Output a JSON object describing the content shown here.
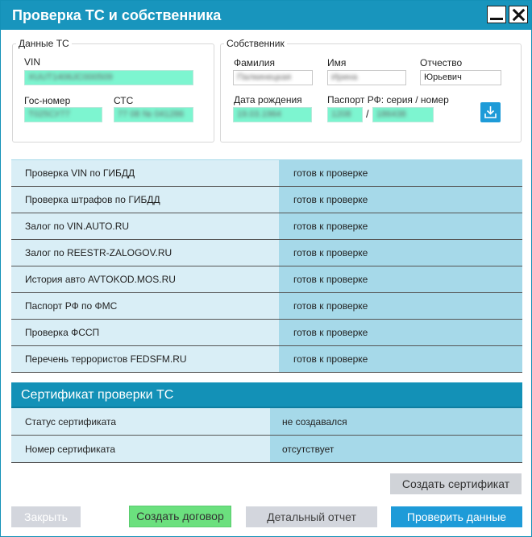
{
  "window": {
    "title": "Проверка ТС и собственника",
    "accent_color": "#1895bd"
  },
  "vehicle": {
    "legend": "Данные ТС",
    "vin_label": "VIN",
    "vin_value": "XUUT1406JC000509",
    "plate_label": "Гос-номер",
    "plate_value": "Т025СУ77",
    "sts_label": "СТС",
    "sts_value": "77 08 № 041286"
  },
  "owner": {
    "legend": "Собственник",
    "surname_label": "Фамилия",
    "surname_value": "Палкинецкая",
    "name_label": "Имя",
    "name_value": "Ирина",
    "patronymic_label": "Отчество",
    "patronymic_value": "Юрьевич",
    "birth_label": "Дата рождения",
    "birth_value": "19.03.1964",
    "passport_label": "Паспорт РФ: серия / номер",
    "passport_series": "1208",
    "passport_slash": "/",
    "passport_number": "186438",
    "download_icon": "download-icon"
  },
  "checks": [
    {
      "name": "Проверка VIN по ГИБДД",
      "status": "готов к проверке"
    },
    {
      "name": "Проверка штрафов по ГИБДД",
      "status": "готов к проверке"
    },
    {
      "name": "Залог по VIN.AUTO.RU",
      "status": "готов к проверке"
    },
    {
      "name": "Залог по REESTR-ZALOGOV.RU",
      "status": "готов к проверке"
    },
    {
      "name": "История авто AVTOKOD.MOS.RU",
      "status": "готов к проверке"
    },
    {
      "name": "Паспорт РФ по ФМС",
      "status": "готов к проверке"
    },
    {
      "name": "Проверка ФССП",
      "status": "готов к проверке"
    },
    {
      "name": "Перечень террористов FEDSFM.RU",
      "status": "готов к проверке"
    }
  ],
  "certificate": {
    "header": "Сертификат проверки ТС",
    "rows": [
      {
        "name": "Статус сертификата",
        "value": "не создавался"
      },
      {
        "name": "Номер сертификата",
        "value": "отсутствует"
      }
    ]
  },
  "buttons": {
    "create_cert": "Создать сертификат",
    "close": "Закрыть",
    "create_contract": "Создать договор",
    "detailed_report": "Детальный отчет",
    "check_data": "Проверить данные"
  }
}
